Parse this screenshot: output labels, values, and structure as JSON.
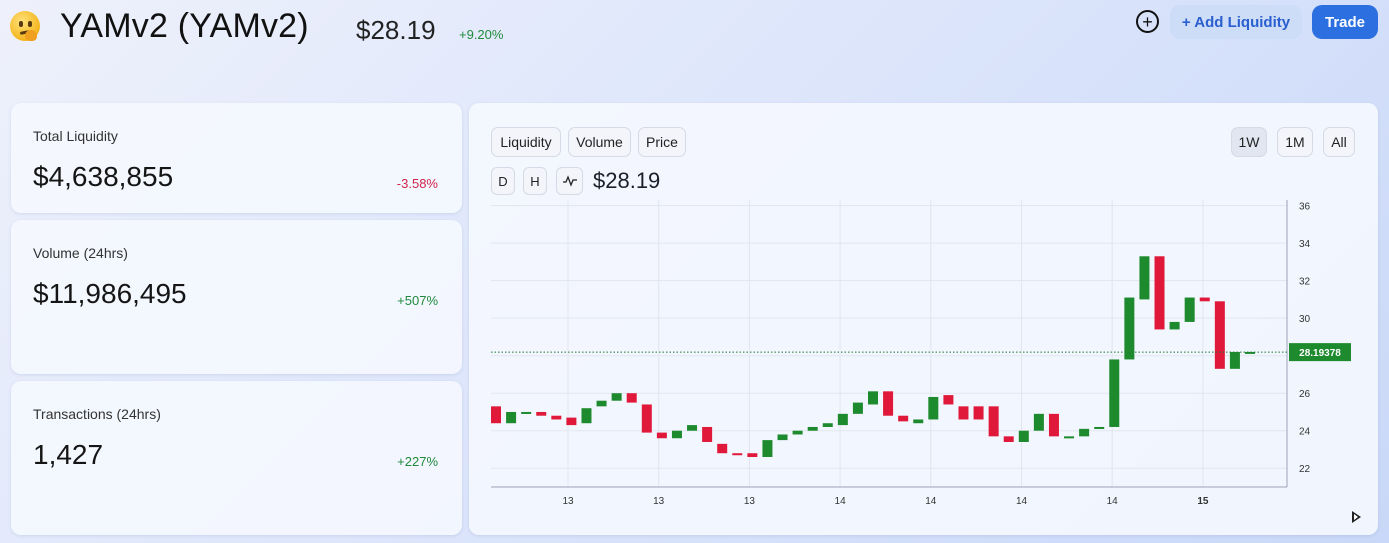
{
  "header": {
    "token_title": "YAMv2 (YAMv2)",
    "price": "$28.19",
    "change": "+9.20%",
    "add_liquidity_label": "+ Add Liquidity",
    "trade_label": "Trade",
    "plus_icon": "plus-circle-icon"
  },
  "stats": [
    {
      "label": "Total Liquidity",
      "value": "$4,638,855",
      "change": "-3.58%"
    },
    {
      "label": "Volume (24hrs)",
      "value": "$11,986,495",
      "change": "+507%"
    },
    {
      "label": "Transactions (24hrs)",
      "value": "1,427",
      "change": "+227%"
    }
  ],
  "chart_controls": {
    "tabs": [
      "Liquidity",
      "Volume",
      "Price"
    ],
    "ranges": [
      "1W",
      "1M",
      "All"
    ],
    "active_range": "1W",
    "intervals": [
      "D",
      "H"
    ],
    "line_icon": "line-chart-icon",
    "current_price": "$28.19"
  },
  "colors": {
    "up": "#1e8a2e",
    "down": "#e0193a",
    "accent": "#2b6fe0"
  },
  "chart_data": {
    "type": "candlestick",
    "y_ticks": [
      22,
      24,
      26,
      28,
      30,
      32,
      34,
      36
    ],
    "ylim": [
      21,
      36.3
    ],
    "x_tick_labels": [
      "13",
      "13",
      "13",
      "14",
      "14",
      "14",
      "14",
      "15"
    ],
    "last_price_label": "28.19378",
    "last_price": 28.19,
    "candles": [
      {
        "o": 25.3,
        "c": 24.4
      },
      {
        "o": 24.4,
        "c": 25.0
      },
      {
        "o": 24.9,
        "c": 25.0
      },
      {
        "o": 25.0,
        "c": 24.8
      },
      {
        "o": 24.8,
        "c": 24.6
      },
      {
        "o": 24.7,
        "c": 24.3
      },
      {
        "o": 24.4,
        "c": 25.2
      },
      {
        "o": 25.3,
        "c": 25.6
      },
      {
        "o": 25.6,
        "c": 26.0
      },
      {
        "o": 26.0,
        "c": 25.5
      },
      {
        "o": 25.4,
        "c": 23.9
      },
      {
        "o": 23.9,
        "c": 23.6
      },
      {
        "o": 23.6,
        "c": 24.0
      },
      {
        "o": 24.0,
        "c": 24.3
      },
      {
        "o": 24.2,
        "c": 23.4
      },
      {
        "o": 23.3,
        "c": 22.8
      },
      {
        "o": 22.8,
        "c": 22.7
      },
      {
        "o": 22.8,
        "c": 22.6
      },
      {
        "o": 22.6,
        "c": 23.5
      },
      {
        "o": 23.5,
        "c": 23.8
      },
      {
        "o": 23.8,
        "c": 24.0
      },
      {
        "o": 24.0,
        "c": 24.2
      },
      {
        "o": 24.2,
        "c": 24.4
      },
      {
        "o": 24.3,
        "c": 24.9
      },
      {
        "o": 24.9,
        "c": 25.5
      },
      {
        "o": 25.4,
        "c": 26.1
      },
      {
        "o": 26.1,
        "c": 24.8
      },
      {
        "o": 24.8,
        "c": 24.5
      },
      {
        "o": 24.4,
        "c": 24.6
      },
      {
        "o": 24.6,
        "c": 25.8
      },
      {
        "o": 25.9,
        "c": 25.4
      },
      {
        "o": 25.3,
        "c": 24.6
      },
      {
        "o": 25.3,
        "c": 24.6
      },
      {
        "o": 25.3,
        "c": 23.7
      },
      {
        "o": 23.7,
        "c": 23.4
      },
      {
        "o": 23.4,
        "c": 24.0
      },
      {
        "o": 24.0,
        "c": 24.9
      },
      {
        "o": 24.9,
        "c": 23.7
      },
      {
        "o": 23.7,
        "c": 23.7
      },
      {
        "o": 23.7,
        "c": 24.1
      },
      {
        "o": 24.1,
        "c": 24.2
      },
      {
        "o": 24.2,
        "c": 27.8
      },
      {
        "o": 27.8,
        "c": 31.1
      },
      {
        "o": 31.0,
        "c": 33.3
      },
      {
        "o": 33.3,
        "c": 29.4
      },
      {
        "o": 29.4,
        "c": 29.8
      },
      {
        "o": 29.8,
        "c": 31.1
      },
      {
        "o": 31.1,
        "c": 30.9
      },
      {
        "o": 30.9,
        "c": 27.3
      },
      {
        "o": 27.3,
        "c": 28.2
      },
      {
        "o": 28.2,
        "c": 28.2
      }
    ]
  }
}
